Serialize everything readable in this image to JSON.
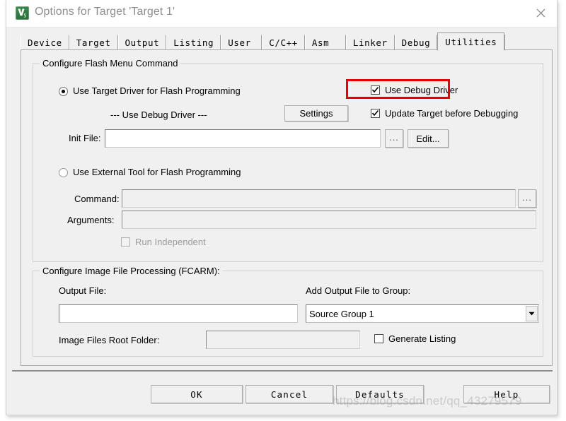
{
  "window": {
    "title": "Options for Target 'Target 1'",
    "icon": "keil-uvision5-icon",
    "close_label": "×"
  },
  "tabs": [
    {
      "label": "Device",
      "selected": false
    },
    {
      "label": "Target",
      "selected": false
    },
    {
      "label": "Output",
      "selected": false
    },
    {
      "label": "Listing",
      "selected": false
    },
    {
      "label": "User",
      "selected": false
    },
    {
      "label": "C/C++",
      "selected": false
    },
    {
      "label": "Asm",
      "selected": false
    },
    {
      "label": "Linker",
      "selected": false
    },
    {
      "label": "Debug",
      "selected": false
    },
    {
      "label": "Utilities",
      "selected": true
    }
  ],
  "flash_group": {
    "legend": "Configure Flash Menu Command",
    "use_target_driver": {
      "label": "Use Target Driver for Flash Programming",
      "checked": true
    },
    "driver_name": "--- Use Debug Driver ---",
    "settings_button": "Settings",
    "use_debug_driver": {
      "label": "Use Debug Driver",
      "checked": true,
      "highlighted": true
    },
    "update_target": {
      "label": "Update Target before Debugging",
      "checked": true
    },
    "init_file": {
      "label": "Init File:",
      "value": "",
      "browse_button": "...",
      "edit_button": "Edit..."
    },
    "use_external_tool": {
      "label": "Use External Tool for Flash Programming",
      "checked": false
    },
    "command": {
      "label": "Command:",
      "value": "",
      "browse_button": "..."
    },
    "arguments": {
      "label": "Arguments:",
      "value": ""
    },
    "run_independent": {
      "label": "Run Independent",
      "checked": false,
      "disabled": true
    }
  },
  "fcarm_group": {
    "legend": "Configure Image File Processing (FCARM):",
    "output_file": {
      "label": "Output File:",
      "value": ""
    },
    "add_output_group": {
      "label": "Add Output File  to Group:",
      "value": "Source Group 1"
    },
    "image_root_folder": {
      "label": "Image Files Root Folder:",
      "value": ""
    },
    "generate_listing": {
      "label": "Generate Listing",
      "checked": false
    }
  },
  "footer": {
    "ok": "OK",
    "cancel": "Cancel",
    "defaults": "Defaults",
    "help": "Help"
  },
  "watermark": "https://blog.csdn.net/qq_43279579",
  "colors": {
    "dialog_bg": "#f0f0f0",
    "highlight": "#e60000",
    "title_text": "#8e8e8e",
    "icon_green": "#2f7a41"
  }
}
